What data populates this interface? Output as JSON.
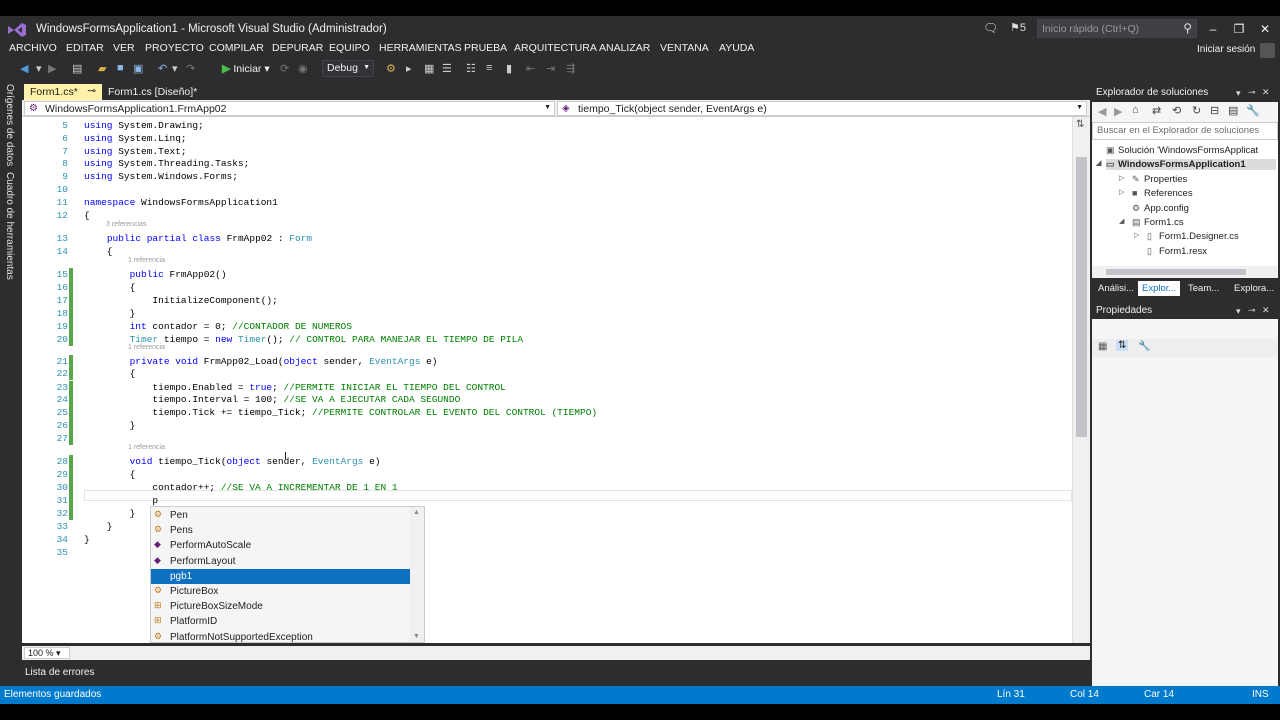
{
  "window": {
    "title": "WindowsFormsApplication1 - Microsoft Visual Studio (Administrador)",
    "notification_count": "5",
    "quick_launch_placeholder": "Inicio rápido (Ctrl+Q)",
    "minimize": "–",
    "restore": "❐",
    "close": "✕"
  },
  "menu": {
    "items": [
      "ARCHIVO",
      "EDITAR",
      "VER",
      "PROYECTO",
      "COMPILAR",
      "DEPURAR",
      "EQUIPO",
      "HERRAMIENTAS",
      "PRUEBA",
      "ARQUITECTURA",
      "ANALIZAR",
      "VENTANA",
      "AYUDA"
    ],
    "signin": "Iniciar sesión"
  },
  "toolbar": {
    "run_label": "Iniciar",
    "configuration": "Debug"
  },
  "left_strip": {
    "data_sources": "Orígenes de datos",
    "toolbox": "Cuadro de herramientas"
  },
  "tabs": {
    "active": "Form1.cs*",
    "designer": "Form1.cs [Diseño]*"
  },
  "navbar": {
    "class_selector": "WindowsFormsApplication1.FrmApp02",
    "member_selector": "tiempo_Tick(object sender, EventArgs e)"
  },
  "editor": {
    "zoom": "100 %",
    "lens_3ref": "3 referencias",
    "lens_1ref": "1 referencia",
    "lines": [
      {
        "n": "5",
        "text": "using System.Drawing;"
      },
      {
        "n": "6",
        "text": "using System.Linq;"
      },
      {
        "n": "7",
        "text": "using System.Text;"
      },
      {
        "n": "8",
        "text": "using System.Threading.Tasks;"
      },
      {
        "n": "9",
        "text": "using System.Windows.Forms;"
      },
      {
        "n": "10",
        "text": ""
      },
      {
        "n": "11",
        "text": "namespace WindowsFormsApplication1"
      },
      {
        "n": "12",
        "text": "{"
      },
      {
        "n": "13",
        "text": "    public partial class FrmApp02 : Form"
      },
      {
        "n": "14",
        "text": "    {"
      },
      {
        "n": "15",
        "text": "        public FrmApp02()"
      },
      {
        "n": "16",
        "text": "        {"
      },
      {
        "n": "17",
        "text": "            InitializeComponent();"
      },
      {
        "n": "18",
        "text": "        }"
      },
      {
        "n": "19",
        "text": "        int contador = 0; //CONTADOR DE NUMEROS"
      },
      {
        "n": "20",
        "text": "        Timer tiempo = new Timer(); // CONTROL PARA MANEJAR EL TIEMPO DE PILA"
      },
      {
        "n": "21",
        "text": "        private void FrmApp02_Load(object sender, EventArgs e)"
      },
      {
        "n": "22",
        "text": "        {"
      },
      {
        "n": "23",
        "text": "            tiempo.Enabled = true; //PERMITE INICIAR EL TIEMPO DEL CONTROL"
      },
      {
        "n": "24",
        "text": "            tiempo.Interval = 100; //SE VA A EJECUTAR CADA SEGUNDO"
      },
      {
        "n": "25",
        "text": "            tiempo.Tick += tiempo_Tick; //PERMITE CONTROLAR EL EVENTO DEL CONTROL (TIEMPO)"
      },
      {
        "n": "26",
        "text": "        }"
      },
      {
        "n": "27",
        "text": ""
      },
      {
        "n": "28",
        "text": "        void tiempo_Tick(object sender, EventArgs e)"
      },
      {
        "n": "29",
        "text": "        {"
      },
      {
        "n": "30",
        "text": "            contador++; //SE VA A INCREMENTAR DE 1 EN 1"
      },
      {
        "n": "31",
        "text": "            p"
      },
      {
        "n": "32",
        "text": "        }"
      },
      {
        "n": "33",
        "text": "    }"
      },
      {
        "n": "34",
        "text": "}"
      },
      {
        "n": "35",
        "text": ""
      }
    ]
  },
  "intellisense": {
    "items": [
      {
        "label": "Pen",
        "icon": "class-icon"
      },
      {
        "label": "Pens",
        "icon": "class-icon"
      },
      {
        "label": "PerformAutoScale",
        "icon": "method-icon"
      },
      {
        "label": "PerformLayout",
        "icon": "method-icon"
      },
      {
        "label": "pgb1",
        "icon": "field-icon"
      },
      {
        "label": "PictureBox",
        "icon": "class-icon"
      },
      {
        "label": "PictureBoxSizeMode",
        "icon": "enum-icon"
      },
      {
        "label": "PlatformID",
        "icon": "enum-icon"
      },
      {
        "label": "PlatformNotSupportedException",
        "icon": "class-icon"
      }
    ],
    "selected_index": 4
  },
  "solution_explorer": {
    "title": "Explorador de soluciones",
    "search_placeholder": "Buscar en el Explorador de soluciones",
    "tree": [
      {
        "label": "Solución 'WindowsFormsApplicat",
        "depth": 0
      },
      {
        "label": "WindowsFormsApplication1",
        "depth": 1
      },
      {
        "label": "Properties",
        "depth": 2
      },
      {
        "label": "References",
        "depth": 2
      },
      {
        "label": "App.config",
        "depth": 2
      },
      {
        "label": "Form1.cs",
        "depth": 2
      },
      {
        "label": "Form1.Designer.cs",
        "depth": 3
      },
      {
        "label": "Form1.resx",
        "depth": 3
      }
    ],
    "tabs": [
      "Análisi...",
      "Explor...",
      "Team...",
      "Explora..."
    ]
  },
  "properties": {
    "title": "Propiedades"
  },
  "error_list": {
    "label": "Lista de errores"
  },
  "status": {
    "message": "Elementos guardados",
    "line": "Lín 31",
    "col": "Col 14",
    "char": "Car 14",
    "mode": "INS"
  }
}
